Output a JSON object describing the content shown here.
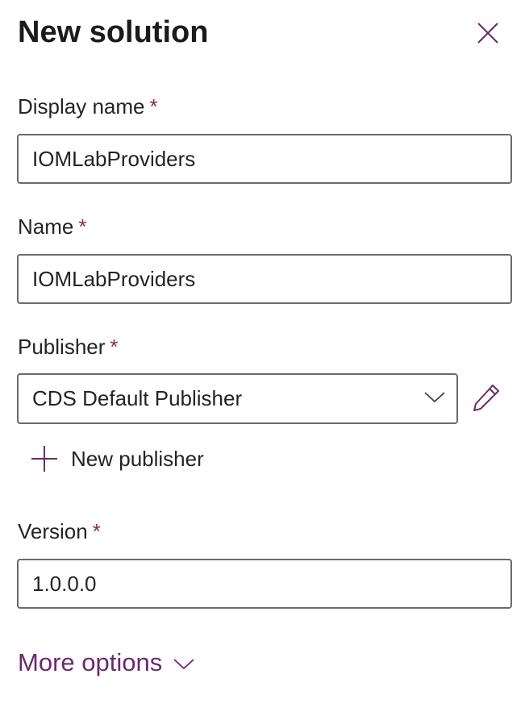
{
  "panel": {
    "title": "New solution",
    "close_icon": "close-icon"
  },
  "fields": {
    "display_name": {
      "label": "Display name",
      "required_mark": "*",
      "value": "IOMLabProviders"
    },
    "name": {
      "label": "Name",
      "required_mark": "*",
      "value": "IOMLabProviders"
    },
    "publisher": {
      "label": "Publisher",
      "required_mark": "*",
      "selected": "CDS Default Publisher",
      "dropdown_icon": "chevron-down-icon",
      "edit_icon": "pencil-icon"
    },
    "version": {
      "label": "Version",
      "required_mark": "*",
      "value": "1.0.0.0"
    }
  },
  "actions": {
    "new_publisher_label": "New publisher",
    "new_publisher_icon": "plus-icon",
    "more_options_label": "More options",
    "more_options_icon": "chevron-down-icon"
  },
  "colors": {
    "accent": "#6a2a6e",
    "required": "#8a2a46",
    "border": "#6b6b6b",
    "text": "#242424"
  }
}
